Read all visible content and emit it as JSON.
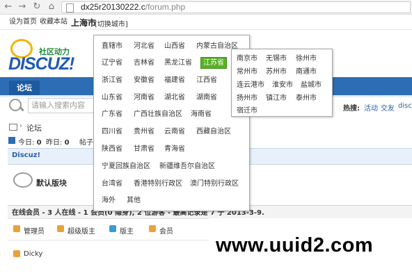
{
  "browser": {
    "back": "←",
    "forward": "→",
    "reload": "↻",
    "home": "⌂",
    "url_host": "dx25r20130222.c",
    "url_path": "/forum.php"
  },
  "toplinks": {
    "set_home": "设为首页",
    "bookmark": "收藏本站",
    "city": "上海市",
    "switch_city": "[切换城市]"
  },
  "logo": {
    "slogan": "社区动力",
    "brand": "DISCUZ!"
  },
  "nav": {
    "forum": "论坛"
  },
  "search": {
    "placeholder": "请输入搜索内容"
  },
  "hot": {
    "label": "热搜:",
    "items": [
      "活动",
      "交友",
      "discu"
    ]
  },
  "breadcrumb": {
    "forum": "论坛"
  },
  "stats": {
    "today_label": "今日:",
    "today": "0",
    "yesterday_label": "昨日:",
    "yesterday": "0",
    "posts_label": "帖子"
  },
  "category": {
    "title": "Discuz!"
  },
  "forum": {
    "name": "默认版块"
  },
  "online": {
    "title": "在线会员 - 3 人在线 - 1 会员(0 隐身), 2 位游客 - 最高记录是 7 于 2013-3-9.",
    "groups": [
      "管理员",
      "超级版主",
      "版主",
      "会员"
    ],
    "users": [
      "Dicky"
    ]
  },
  "provinces": [
    [
      "直辖市",
      "河北省",
      "山西省",
      "内蒙古自治区"
    ],
    [
      "辽宁省",
      "吉林省",
      "黑龙江省",
      "江苏省"
    ],
    [
      "浙江省",
      "安徽省",
      "福建省",
      "江西省"
    ],
    [
      "山东省",
      "河南省",
      "湖北省",
      "湖南省"
    ],
    [
      "广东省",
      "广西壮族自治区",
      "海南省"
    ],
    [
      "四川省",
      "贵州省",
      "云南省",
      "西藏自治区"
    ],
    [
      "陕西省",
      "甘肃省",
      "青海省"
    ],
    [
      "宁夏回族自治区",
      "新疆维吾尔自治区"
    ],
    [
      "台湾省",
      "香港特别行政区",
      "澳门特别行政区"
    ],
    [
      "海外",
      "其他"
    ]
  ],
  "cities": [
    [
      "南京市",
      "无锡市",
      "徐州市"
    ],
    [
      "常州市",
      "苏州市",
      "南通市"
    ],
    [
      "连云港市",
      "淮安市",
      "盐城市"
    ],
    [
      "扬州市",
      "镇江市",
      "泰州市"
    ],
    [
      "宿迁市"
    ]
  ],
  "watermark": "www.uuid2.com"
}
